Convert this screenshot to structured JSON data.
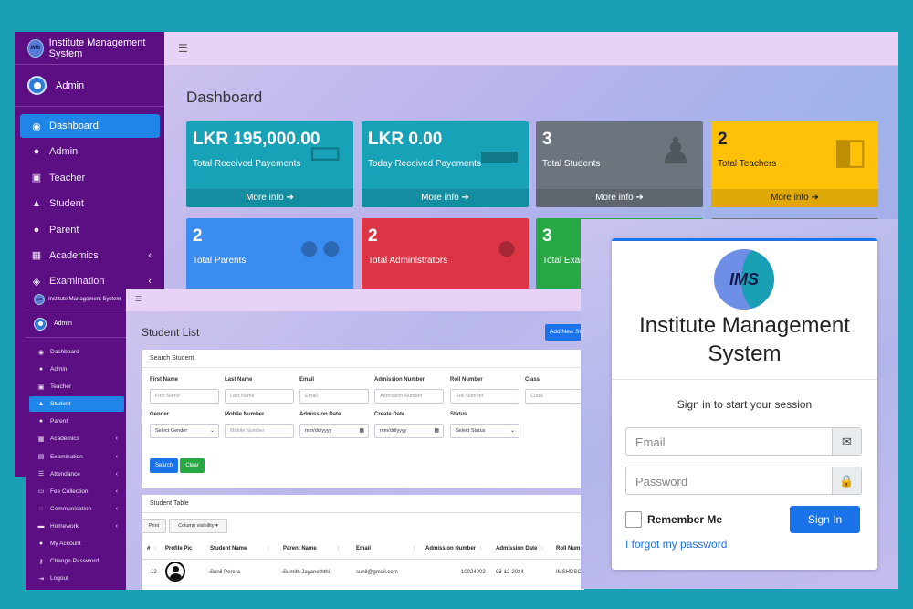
{
  "dashboard": {
    "brand": "Institute Management System",
    "user": "Admin",
    "page_title": "Dashboard",
    "nav": [
      {
        "label": "Dashboard",
        "icon": "dashboard-icon",
        "active": true
      },
      {
        "label": "Admin",
        "icon": "user-icon"
      },
      {
        "label": "Teacher",
        "icon": "teacher-icon"
      },
      {
        "label": "Student",
        "icon": "student-icon"
      },
      {
        "label": "Parent",
        "icon": "parents-icon"
      },
      {
        "label": "Academics",
        "icon": "table-icon",
        "chevron": true
      },
      {
        "label": "Examination",
        "icon": "layers-icon",
        "chevron": true
      }
    ],
    "cards": [
      {
        "value": "LKR 195,000.00",
        "label": "Total Received Payements",
        "more": "More info",
        "color": "#17a2b8",
        "icon": "money-icon"
      },
      {
        "value": "LKR 0.00",
        "label": "Today Received Payements",
        "more": "More info",
        "color": "#17a2b8",
        "icon": "credit-card-icon"
      },
      {
        "value": "3",
        "label": "Total Students",
        "more": "More info",
        "color": "#6c757d",
        "icon": "graduate-icon"
      },
      {
        "value": "2",
        "label": "Total Teachers",
        "more": "More info",
        "color": "#ffc107",
        "icon": "chalkboard-teacher-icon"
      },
      {
        "value": "2",
        "label": "Total Parents",
        "color": "#3b8cf0",
        "icon": "users-icon"
      },
      {
        "value": "2",
        "label": "Total Administrators",
        "color": "#dc3545",
        "icon": "admin-tie-icon"
      },
      {
        "value": "3",
        "label": "Total Exar",
        "color": "#28a745",
        "icon": "exam-icon"
      },
      {
        "value": "",
        "label": "",
        "color": "#6c757d",
        "icon": ""
      }
    ]
  },
  "student_list": {
    "brand": "Institute Management System",
    "user": "Admin",
    "page_title": "Student List",
    "add_button": "Add New St",
    "nav": [
      {
        "label": "Dashboard",
        "icon": "dashboard-icon"
      },
      {
        "label": "Admin",
        "icon": "user-icon"
      },
      {
        "label": "Teacher",
        "icon": "teacher-icon"
      },
      {
        "label": "Student",
        "icon": "student-icon",
        "active": true
      },
      {
        "label": "Parent",
        "icon": "parents-icon"
      },
      {
        "label": "Academics",
        "icon": "table-icon",
        "chevron": true
      },
      {
        "label": "Examination",
        "icon": "exam-icon",
        "chevron": true
      },
      {
        "label": "Attendance",
        "icon": "list-icon",
        "chevron": true
      },
      {
        "label": "Fee Collection",
        "icon": "money-icon",
        "chevron": true
      },
      {
        "label": "Communication",
        "icon": "chat-icon",
        "chevron": true
      },
      {
        "label": "Homework",
        "icon": "homework-icon",
        "chevron": true
      },
      {
        "label": "My Account",
        "icon": "account-icon"
      },
      {
        "label": "Change Password",
        "icon": "key-icon"
      },
      {
        "label": "Logout",
        "icon": "logout-icon"
      }
    ],
    "search": {
      "title": "Search Student",
      "fields": [
        {
          "label": "First Name",
          "placeholder": "First Name"
        },
        {
          "label": "Last Name",
          "placeholder": "Last Name"
        },
        {
          "label": "Email",
          "placeholder": "Email"
        },
        {
          "label": "Admission Number",
          "placeholder": "Admission Number"
        },
        {
          "label": "Roll Number",
          "placeholder": "Roll Number"
        },
        {
          "label": "Class",
          "placeholder": "Class"
        },
        {
          "label": "Gender",
          "placeholder": "Select Gender"
        },
        {
          "label": "Mobile Number",
          "placeholder": "Mobile Number"
        },
        {
          "label": "Admission Date",
          "placeholder": "mm/dd/yyyy"
        },
        {
          "label": "Create Date",
          "placeholder": "mm/dd/yyyy"
        },
        {
          "label": "Status",
          "placeholder": "Select Status"
        }
      ],
      "search_button": "Search",
      "clear_button": "Clear"
    },
    "table": {
      "title": "Student Table",
      "print_button": "Print",
      "column_visibility": "Column visibility",
      "headers": [
        "#",
        "Profile Pic",
        "Student Name",
        "Parent Name",
        "Email",
        "Admission Number",
        "Admission Date",
        "Roll Num"
      ],
      "rows": [
        {
          "num": "12",
          "student_name": "Sunil Perera",
          "parent_name": "Sumith Jayaneththi",
          "email": "sunil@gmail.com",
          "admission_number": "10024002",
          "admission_date": "03-12-2024",
          "roll": "IMSHDSC"
        }
      ]
    }
  },
  "login": {
    "logo_text": "IMS",
    "title": "Institute Management System",
    "message": "Sign in to start your session",
    "email_placeholder": "Email",
    "password_placeholder": "Password",
    "remember": "Remember Me",
    "signin": "Sign In",
    "forgot": "I forgot my password"
  }
}
